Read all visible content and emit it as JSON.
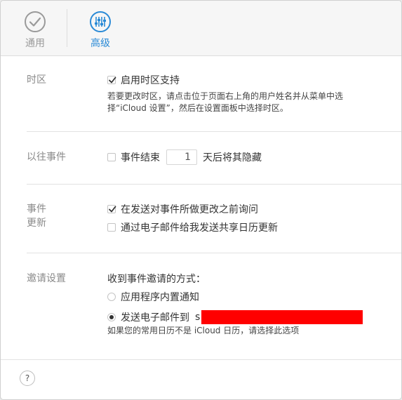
{
  "toolbar": {
    "tabs": [
      {
        "label": "通用",
        "icon": "checkmark-circle-icon"
      },
      {
        "label": "高级",
        "icon": "sliders-icon"
      }
    ],
    "selected": "高级",
    "accent": "#2a8ad6"
  },
  "timezone": {
    "label": "时区",
    "checkbox_label": "启用时区支持",
    "checked": true,
    "desc_line1": "若要更改时区，请点击位于页面右上角的用户姓名并从菜单中选",
    "desc_line2": "择“iCloud 设置”，然后在设置面板中选择时区。"
  },
  "past_events": {
    "label": "以往事件",
    "prefix": "事件结束",
    "days": "1",
    "suffix": "天后将其隐藏",
    "checked": false
  },
  "event_updates": {
    "label_line1": "事件",
    "label_line2": "更新",
    "ask_label": "在发送对事件所做更改之前询问",
    "ask_checked": true,
    "email_label": "通过电子邮件给我发送共享日历更新",
    "email_checked": false
  },
  "invitations": {
    "label": "邀请设置",
    "heading": "收到事件邀请的方式：",
    "option_inapp": "应用程序内置通知",
    "option_email": "发送电子邮件到",
    "email_partial": "s",
    "selected": "email",
    "note": "如果您的常用日历不是 iCloud 日历，请选择此选项"
  },
  "help": {
    "label": "?"
  }
}
